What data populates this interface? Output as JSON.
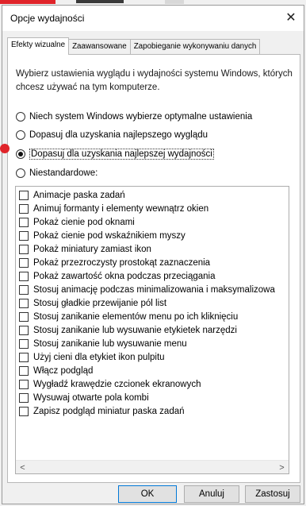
{
  "window": {
    "title": "Opcje wydajności",
    "close_glyph": "✕"
  },
  "tabs": [
    {
      "label": "Efekty wizualne",
      "active": true
    },
    {
      "label": "Zaawansowane",
      "active": false
    },
    {
      "label": "Zapobieganie wykonywaniu danych",
      "active": false
    }
  ],
  "description": "Wybierz ustawienia wyglądu i wydajności systemu Windows, których chcesz używać na tym komputerze.",
  "radios": [
    {
      "label": "Niech system Windows wybierze optymalne ustawienia",
      "checked": false
    },
    {
      "label": "Dopasuj dla uzyskania najlepszego wyglądu",
      "checked": false
    },
    {
      "label": "Dopasuj dla uzyskania najlepszej wydajności",
      "checked": true
    },
    {
      "label": "Niestandardowe:",
      "checked": false
    }
  ],
  "effects": [
    {
      "label": "Animacje paska zadań",
      "checked": false
    },
    {
      "label": "Animuj formanty i elementy wewnątrz okien",
      "checked": false
    },
    {
      "label": "Pokaż cienie pod oknami",
      "checked": false
    },
    {
      "label": "Pokaż cienie pod wskaźnikiem myszy",
      "checked": false
    },
    {
      "label": "Pokaż miniatury zamiast ikon",
      "checked": false
    },
    {
      "label": "Pokaż przezroczysty prostokąt zaznaczenia",
      "checked": false
    },
    {
      "label": "Pokaż zawartość okna podczas przeciągania",
      "checked": false
    },
    {
      "label": "Stosuj animację podczas minimalizowania i maksymalizowa",
      "checked": false
    },
    {
      "label": "Stosuj gładkie przewijanie pól list",
      "checked": false
    },
    {
      "label": "Stosuj zanikanie elementów menu po ich kliknięciu",
      "checked": false
    },
    {
      "label": "Stosuj zanikanie lub wysuwanie etykietek narzędzi",
      "checked": false
    },
    {
      "label": "Stosuj zanikanie lub wysuwanie menu",
      "checked": false
    },
    {
      "label": "Użyj cieni dla etykiet ikon pulpitu",
      "checked": false
    },
    {
      "label": "Włącz podgląd",
      "checked": false
    },
    {
      "label": "Wygładź krawędzie czcionek ekranowych",
      "checked": false
    },
    {
      "label": "Wysuwaj otwarte pola kombi",
      "checked": false
    },
    {
      "label": "Zapisz podgląd miniatur paska zadań",
      "checked": false
    }
  ],
  "scrollbar": {
    "left_glyph": "<",
    "right_glyph": ">"
  },
  "buttons": {
    "ok": "OK",
    "cancel": "Anuluj",
    "apply": "Zastosuj"
  },
  "colors": {
    "annotation_red": "#e0242a",
    "ok_border": "#0078d7"
  }
}
